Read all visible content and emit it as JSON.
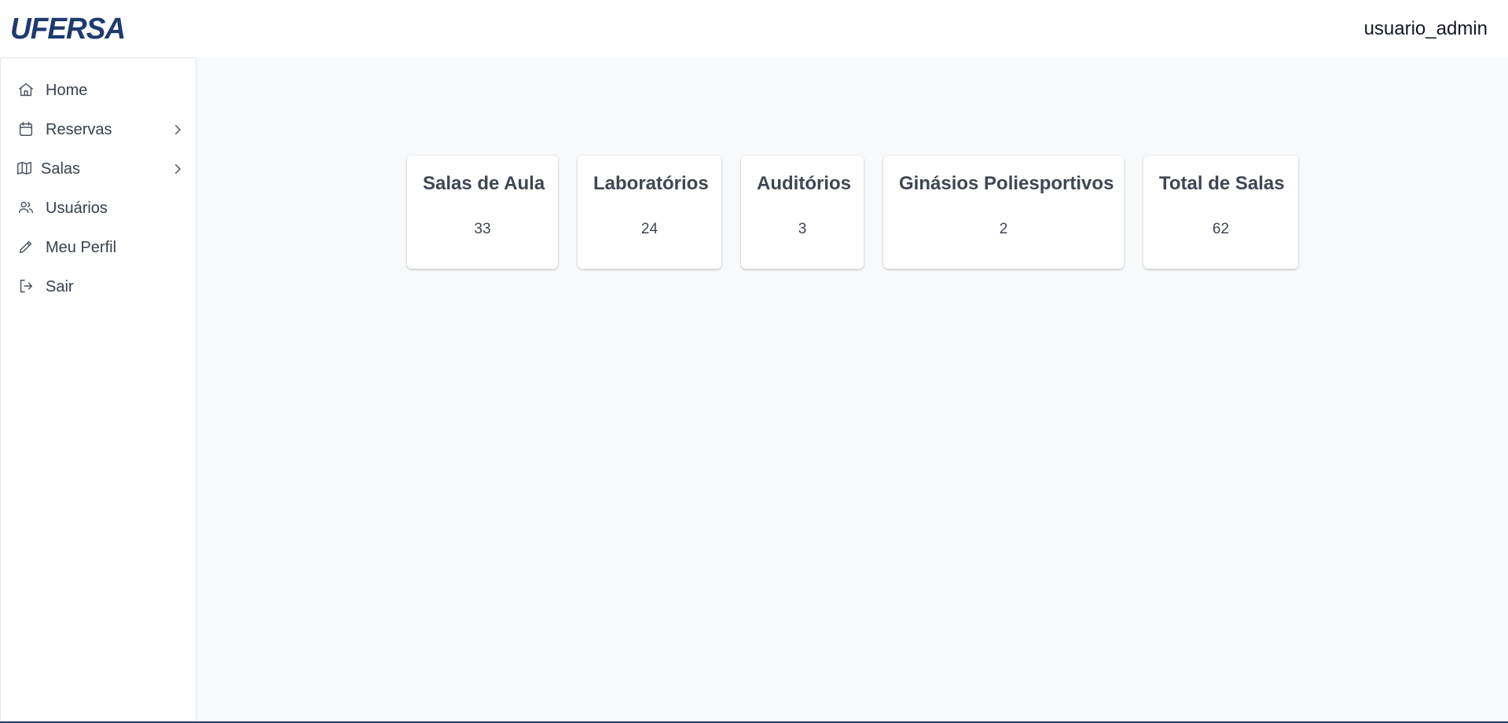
{
  "header": {
    "logo_text": "UFERSA",
    "username": "usuario_admin",
    "brand_color": "#1e3a6e"
  },
  "sidebar": {
    "items": [
      {
        "label": "Home",
        "icon": "home-icon"
      },
      {
        "label": "Reservas",
        "icon": "calendar-icon",
        "has_submenu": true
      },
      {
        "label": "Salas",
        "icon": "map-icon",
        "has_submenu": true
      },
      {
        "label": "Usuários",
        "icon": "users-icon"
      },
      {
        "label": "Meu Perfil",
        "icon": "pencil-icon"
      },
      {
        "label": "Sair",
        "icon": "logout-icon"
      }
    ]
  },
  "stats": [
    {
      "title": "Salas de Aula",
      "value": "33"
    },
    {
      "title": "Laboratórios",
      "value": "24"
    },
    {
      "title": "Auditórios",
      "value": "3"
    },
    {
      "title": "Ginásios Poliesportivos",
      "value": "2"
    },
    {
      "title": "Total de Salas",
      "value": "62"
    }
  ]
}
